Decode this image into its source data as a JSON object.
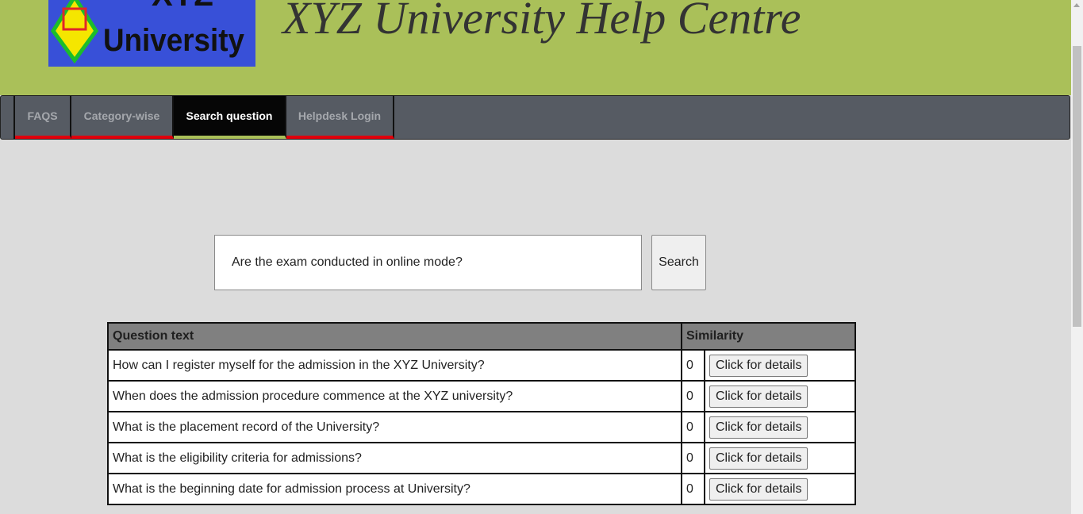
{
  "header": {
    "logo_line1": "XYZ",
    "logo_line2": "University",
    "title": "XYZ University Help Centre"
  },
  "nav": {
    "items": [
      {
        "label": "FAQS",
        "active": false
      },
      {
        "label": "Category-wise",
        "active": false
      },
      {
        "label": "Search question",
        "active": true
      },
      {
        "label": "Helpdesk Login",
        "active": false
      }
    ]
  },
  "search": {
    "value": "Are the exam conducted in online mode?",
    "button_label": "Search"
  },
  "results": {
    "headers": [
      "Question text",
      "Similarity"
    ],
    "rows": [
      {
        "question": "How can I register myself for the admission in the XYZ University?",
        "similarity": "0",
        "action": "Click for details"
      },
      {
        "question": "When does the admission procedure commence at the XYZ university?",
        "similarity": "0",
        "action": "Click for details"
      },
      {
        "question": "What is the placement record of the University?",
        "similarity": "0",
        "action": "Click for details"
      },
      {
        "question": "What is the eligibility criteria for admissions?",
        "similarity": "0",
        "action": "Click for details"
      },
      {
        "question": "What is the beginning date for admission process at University?",
        "similarity": "0",
        "action": "Click for details"
      }
    ]
  },
  "colors": {
    "header_bg": "#aac059",
    "nav_bg": "#565b63",
    "nav_active_bg": "#060606",
    "nav_underline": "#e0000b",
    "page_bg": "#dcdcdc",
    "table_header_bg": "#808080",
    "logo_bg": "#3850d8"
  }
}
